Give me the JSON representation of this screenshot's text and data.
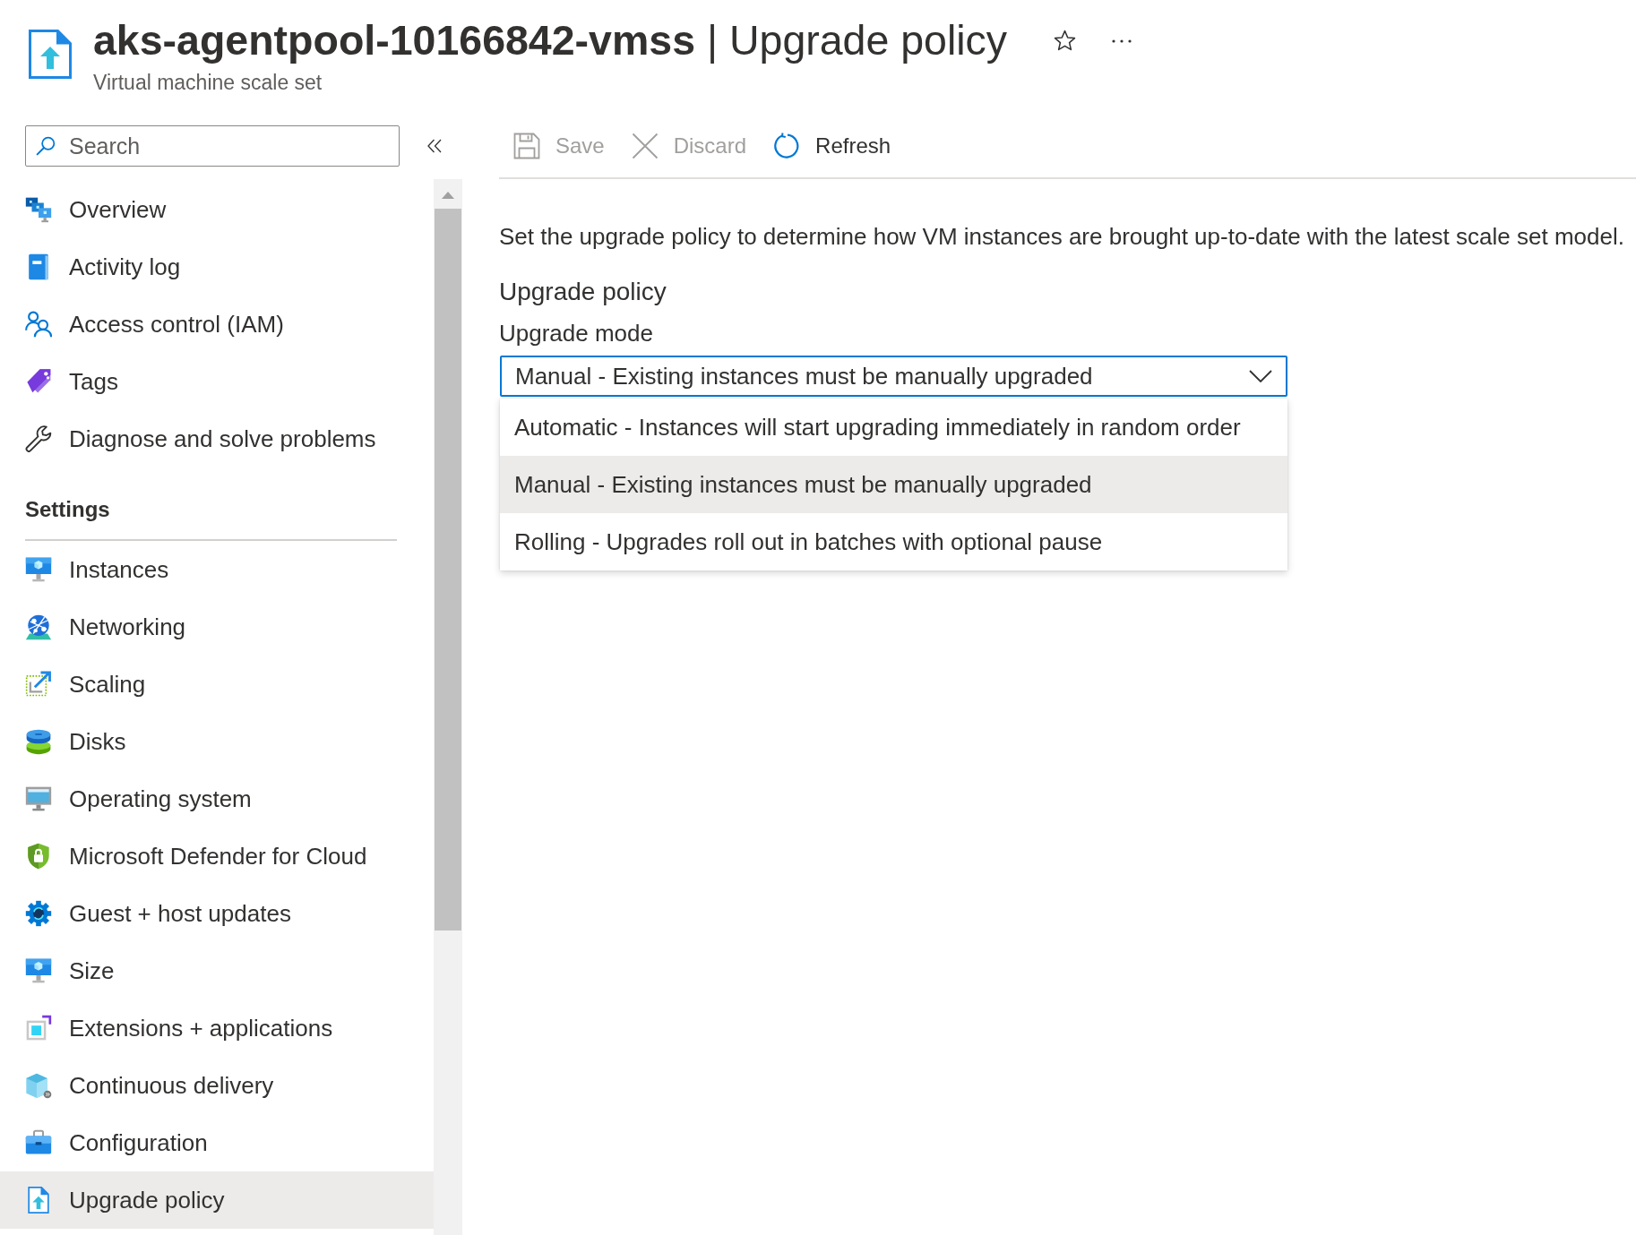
{
  "header": {
    "title": "**aks-agentpool-10166842-vmss** | Upgrade policy",
    "subtitle": "Virtual machine scale set"
  },
  "search": {
    "placeholder": "Search"
  },
  "sidebar": {
    "groups": [
      {
        "items": [
          {
            "label": "Overview",
            "selected": false
          },
          {
            "label": "Activity log",
            "selected": false
          },
          {
            "label": "Access control (IAM)",
            "selected": false
          },
          {
            "label": "Tags",
            "selected": false
          },
          {
            "label": "Diagnose and solve problems",
            "selected": false
          }
        ]
      },
      {
        "heading": "Settings",
        "items": [
          {
            "label": "Instances",
            "selected": false
          },
          {
            "label": "Networking",
            "selected": false
          },
          {
            "label": "Scaling",
            "selected": false
          },
          {
            "label": "Disks",
            "selected": false
          },
          {
            "label": "Operating system",
            "selected": false
          },
          {
            "label": "Microsoft Defender for Cloud",
            "selected": false
          },
          {
            "label": "Guest + host updates",
            "selected": false
          },
          {
            "label": "Size",
            "selected": false
          },
          {
            "label": "Extensions + applications",
            "selected": false
          },
          {
            "label": "Continuous delivery",
            "selected": false
          },
          {
            "label": "Configuration",
            "selected": false
          },
          {
            "label": "Upgrade policy",
            "selected": true
          }
        ]
      }
    ]
  },
  "toolbar": [
    {
      "label": "Save",
      "disabled": true
    },
    {
      "label": "Discard",
      "disabled": true
    },
    {
      "label": "Refresh",
      "disabled": false
    }
  ],
  "content": {
    "description": "Set the upgrade policy to determine how VM instances are brought up-to-date with the latest scale set model.",
    "section_title": "Upgrade policy",
    "field_label": "Upgrade mode",
    "dropdown": {
      "value": "Manual - Existing instances must be manually upgraded",
      "expanded": true,
      "options": [
        {
          "label": "Automatic - Instances will start upgrading immediately in random order",
          "selected": false
        },
        {
          "label": "Manual - Existing instances must be manually upgraded",
          "selected": true
        },
        {
          "label": "Rolling - Upgrades roll out in batches with optional pause",
          "selected": false
        }
      ]
    }
  }
}
